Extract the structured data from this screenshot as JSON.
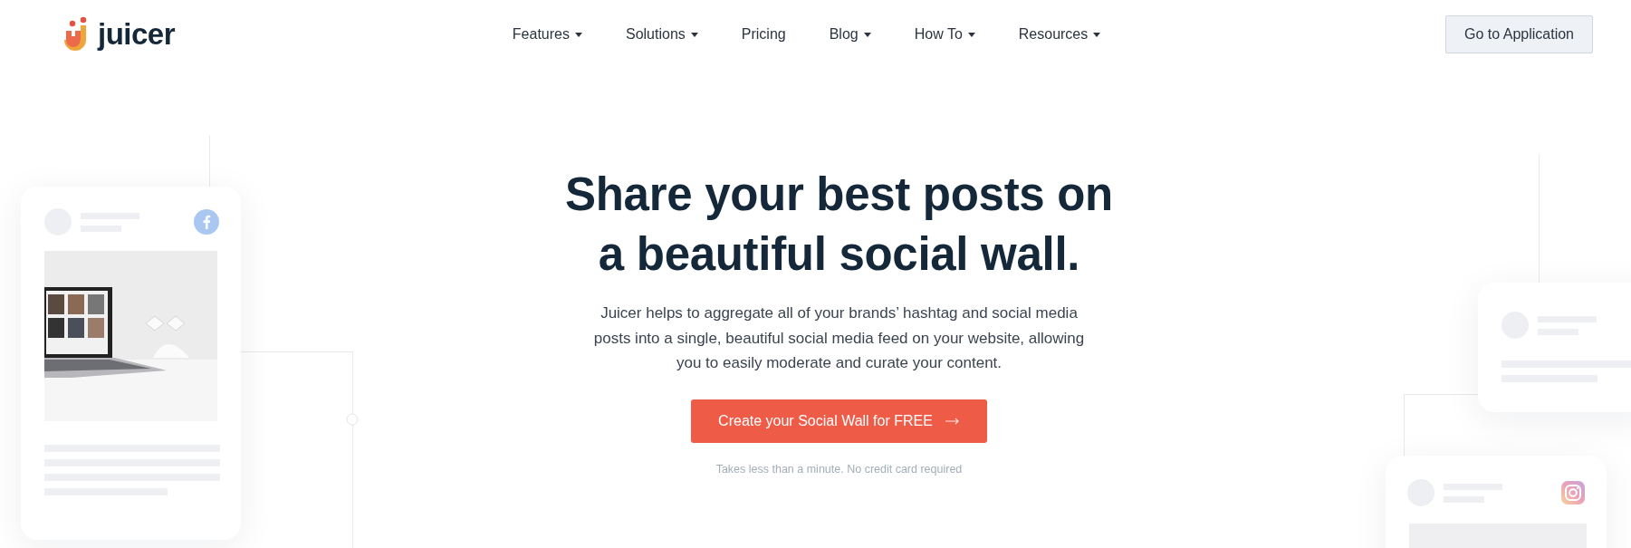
{
  "header": {
    "logo": "juicer",
    "nav": [
      {
        "label": "Features",
        "dropdown": true
      },
      {
        "label": "Solutions",
        "dropdown": true
      },
      {
        "label": "Pricing",
        "dropdown": false
      },
      {
        "label": "Blog",
        "dropdown": true
      },
      {
        "label": "How To",
        "dropdown": true
      },
      {
        "label": "Resources",
        "dropdown": true
      }
    ],
    "app_button": "Go to Application"
  },
  "hero": {
    "title_lines": [
      "Share your best posts on",
      "a beautiful social wall."
    ],
    "description": "Juicer helps to aggregate all of your brands’ hashtag and social media posts into a single, beautiful social media feed on your website, allowing you to easily moderate and curate your content.",
    "cta": "Create your Social Wall for FREE",
    "note": "Takes less than a minute. No credit card required"
  }
}
